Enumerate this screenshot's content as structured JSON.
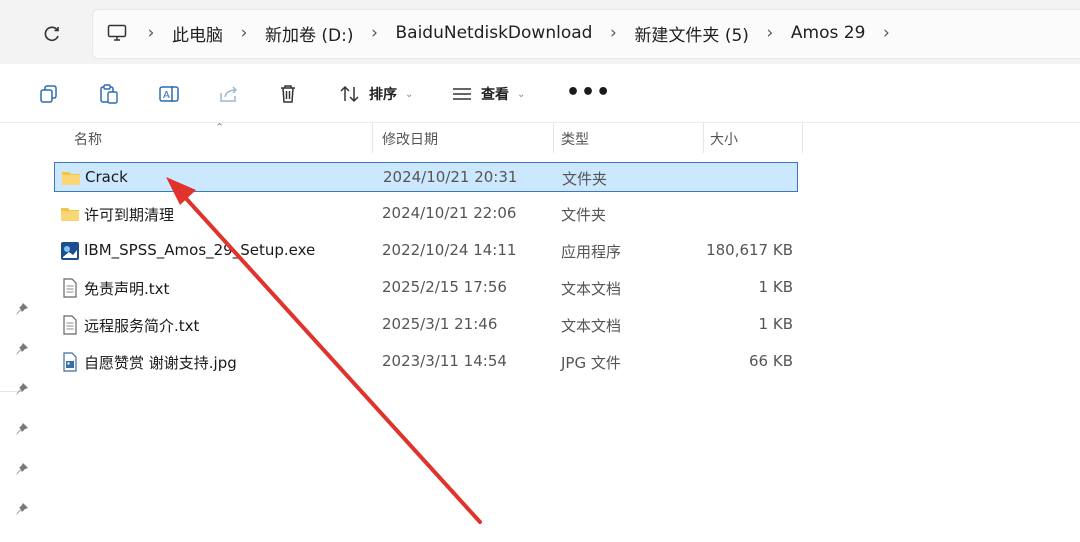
{
  "address_bar": {
    "crumbs": [
      "此电脑",
      "新加卷 (D:)",
      "BaiduNetdiskDownload",
      "新建文件夹 (5)",
      "Amos 29"
    ]
  },
  "toolbar": {
    "sort_label": "排序",
    "view_label": "查看",
    "more_label": "•••"
  },
  "columns": {
    "name": "名称",
    "date": "修改日期",
    "type": "类型",
    "size": "大小"
  },
  "files": [
    {
      "name": "Crack",
      "date": "2024/10/21 20:31",
      "type": "文件夹",
      "size": "",
      "icon": "folder-icon",
      "selected": true
    },
    {
      "name": "许可到期清理",
      "date": "2024/10/21 22:06",
      "type": "文件夹",
      "size": "",
      "icon": "folder-icon",
      "selected": false
    },
    {
      "name": "IBM_SPSS_Amos_29_Setup.exe",
      "date": "2022/10/24 14:11",
      "type": "应用程序",
      "size": "180,617 KB",
      "icon": "exe-icon",
      "selected": false
    },
    {
      "name": "免责声明.txt",
      "date": "2025/2/15 17:56",
      "type": "文本文档",
      "size": "1 KB",
      "icon": "text-file-icon",
      "selected": false
    },
    {
      "name": "远程服务简介.txt",
      "date": "2025/3/1 21:46",
      "type": "文本文档",
      "size": "1 KB",
      "icon": "text-file-icon",
      "selected": false
    },
    {
      "name": "自愿赞赏 谢谢支持.jpg",
      "date": "2023/3/11 14:54",
      "type": "JPG 文件",
      "size": "66 KB",
      "icon": "image-file-icon",
      "selected": false
    }
  ],
  "colors": {
    "selection_bg": "#cce8ff",
    "selection_border": "#3b78c4",
    "annotation_arrow": "#e0332b",
    "folder": "#f6c445"
  }
}
